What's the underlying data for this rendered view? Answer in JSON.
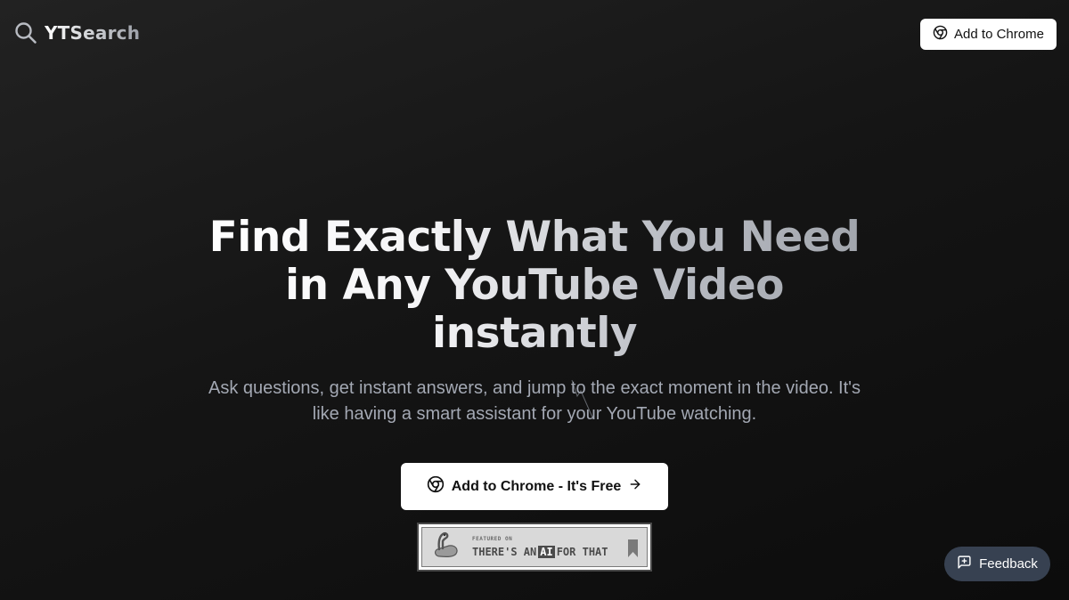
{
  "header": {
    "logo_text": "YTSearch",
    "logo_icon": "search-icon",
    "cta_label": "Add to Chrome",
    "cta_icon": "chrome-icon"
  },
  "hero": {
    "title_lines": [
      "Find Exactly What You Need",
      "in Any YouTube Video",
      "instantly"
    ],
    "subtitle": "Ask questions, get instant answers, and jump to the exact moment in the video. It's like having a smart assistant for your YouTube watching.",
    "cta_label": "Add to Chrome - It's Free",
    "cta_icon": "chrome-icon",
    "cta_arrow_icon": "arrow-right-icon"
  },
  "badge": {
    "small_text": "FEATURED ON",
    "text_before": "THERE'S AN",
    "text_ai": "AI",
    "text_after": "FOR THAT"
  },
  "feedback": {
    "label": "Feedback",
    "icon": "message-plus-icon"
  },
  "colors": {
    "background_top": "#222222",
    "background_bottom": "#0c0c0c",
    "button_bg": "#ffffff",
    "subtitle": "#a3a8b3",
    "feedback_bg": "#374151"
  }
}
